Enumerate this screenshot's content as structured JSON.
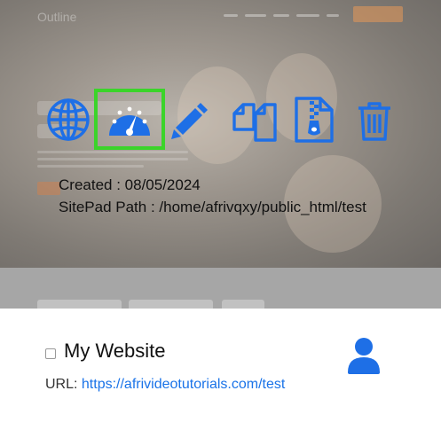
{
  "preview": {
    "ghost_logo": "Outline"
  },
  "actions": [
    {
      "name": "globe-icon",
      "label": "Visit site"
    },
    {
      "name": "dashboard-icon",
      "label": "Open dashboard",
      "selected": true
    },
    {
      "name": "pencil-icon",
      "label": "Edit"
    },
    {
      "name": "copy-icon",
      "label": "Clone"
    },
    {
      "name": "zip-file-icon",
      "label": "Download zip"
    },
    {
      "name": "trash-icon",
      "label": "Delete"
    }
  ],
  "info": {
    "created_label": "Created :",
    "created_value": "08/05/2024",
    "path_label": "SitePad Path :",
    "path_value": "/home/afrivqxy/public_html/test"
  },
  "site": {
    "name": "My Website",
    "url_label": "URL:",
    "url": "https://afrivideotutorials.com/test"
  },
  "colors": {
    "icon_blue": "#1e6fe6",
    "selected_outline": "#3bd42a",
    "link": "#1a73e8"
  }
}
